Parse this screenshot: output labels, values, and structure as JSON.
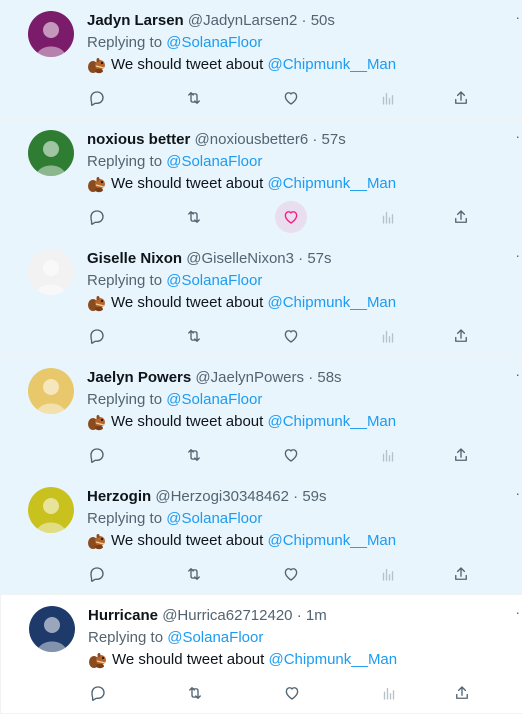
{
  "feed": {
    "tweets": [
      {
        "name": "Jadyn Larsen",
        "handle": "@JadynLarsen2",
        "time": "50s",
        "replying_prefix": "Replying to",
        "replying_to": "@SolanaFloor",
        "text": "We should tweet about",
        "mention": "@Chipmunk__Man",
        "emoji": "chipmunk-emoji",
        "unread": true,
        "avatar_color": "#7b1c6a",
        "like_hover": false
      },
      {
        "name": "noxious better",
        "handle": "@noxiousbetter6",
        "time": "57s",
        "replying_prefix": "Replying to",
        "replying_to": "@SolanaFloor",
        "text": "We should tweet about",
        "mention": "@Chipmunk__Man",
        "emoji": "chipmunk-emoji",
        "unread": true,
        "avatar_color": "#2f7d32",
        "like_hover": true
      },
      {
        "name": "Giselle Nixon",
        "handle": "@GiselleNixon3",
        "time": "57s",
        "replying_prefix": "Replying to",
        "replying_to": "@SolanaFloor",
        "text": "We should tweet about",
        "mention": "@Chipmunk__Man",
        "emoji": "chipmunk-emoji",
        "unread": true,
        "avatar_color": "#f2f2f2",
        "like_hover": false
      },
      {
        "name": "Jaelyn Powers",
        "handle": "@JaelynPowers",
        "time": "58s",
        "replying_prefix": "Replying to",
        "replying_to": "@SolanaFloor",
        "text": "We should tweet about",
        "mention": "@Chipmunk__Man",
        "emoji": "chipmunk-emoji",
        "unread": true,
        "avatar_color": "#e8c86a",
        "like_hover": false
      },
      {
        "name": "Herzogin",
        "handle": "@Herzogi30348462",
        "time": "59s",
        "replying_prefix": "Replying to",
        "replying_to": "@SolanaFloor",
        "text": "We should tweet about",
        "mention": "@Chipmunk__Man",
        "emoji": "chipmunk-emoji",
        "unread": true,
        "avatar_color": "#c9c21e",
        "like_hover": false
      },
      {
        "name": "Hurricane",
        "handle": "@Hurrica62712420",
        "time": "1m",
        "replying_prefix": "Replying to",
        "replying_to": "@SolanaFloor",
        "text": "We should tweet about",
        "mention": "@Chipmunk__Man",
        "emoji": "chipmunk-emoji",
        "unread": false,
        "avatar_color": "#1e3a6b",
        "like_hover": false
      }
    ],
    "separator": "·",
    "more_glyph": "·"
  },
  "colors": {
    "link": "#1d9bf0",
    "muted": "#536471",
    "unread_bg": "#e8f5fd",
    "like": "#f91880"
  },
  "icons": {
    "reply": "reply-icon",
    "retweet": "retweet-icon",
    "like": "heart-icon",
    "views": "views-chart-icon",
    "share": "share-icon",
    "more": "more-icon"
  }
}
